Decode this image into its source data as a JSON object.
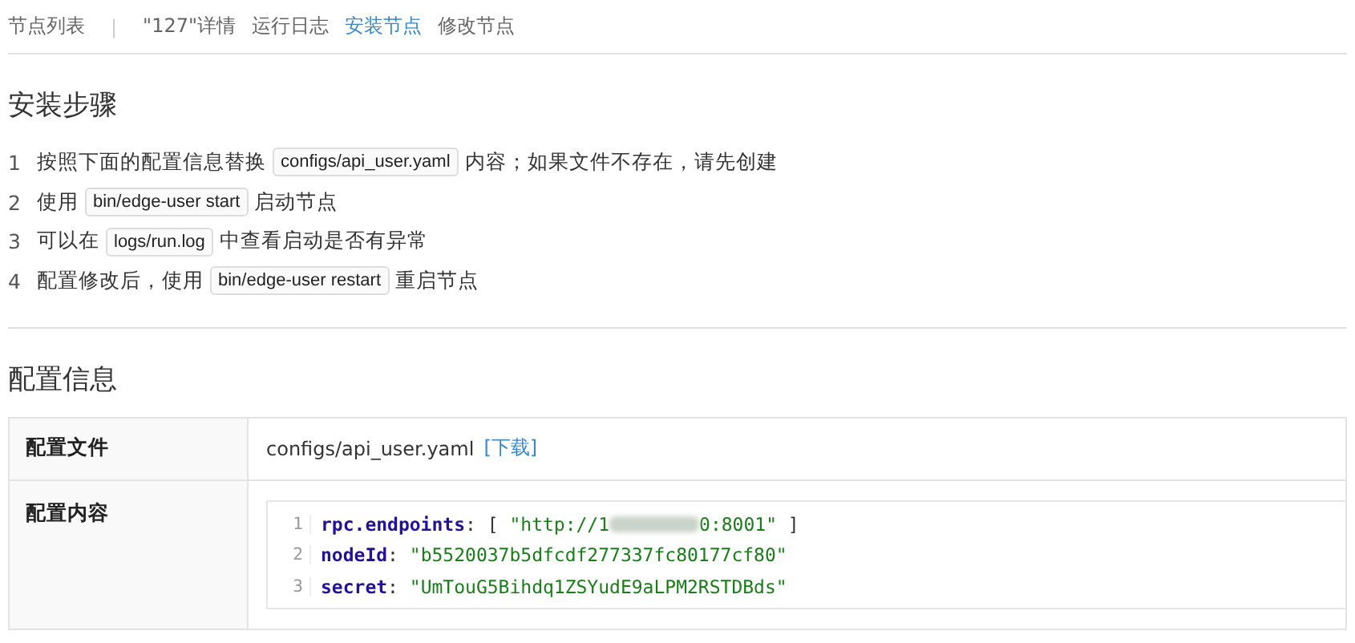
{
  "tabs": [
    {
      "label": "节点列表",
      "selected": false
    },
    {
      "label": "\"127\"详情",
      "selected": false
    },
    {
      "label": "运行日志",
      "selected": false
    },
    {
      "label": "安装节点",
      "selected": true
    },
    {
      "label": "修改节点",
      "selected": false
    }
  ],
  "tab_separator": "|",
  "install": {
    "title": "安装步骤",
    "steps": [
      {
        "number": "1",
        "parts": [
          {
            "kind": "text",
            "text": "按照下面的配置信息替换"
          },
          {
            "kind": "code",
            "text": "configs/api_user.yaml"
          },
          {
            "kind": "text",
            "text": "内容；如果文件不存在，请先创建"
          }
        ]
      },
      {
        "number": "2",
        "parts": [
          {
            "kind": "text",
            "text": "使用"
          },
          {
            "kind": "code",
            "text": "bin/edge-user start"
          },
          {
            "kind": "text",
            "text": "启动节点"
          }
        ]
      },
      {
        "number": "3",
        "parts": [
          {
            "kind": "text",
            "text": "可以在"
          },
          {
            "kind": "code",
            "text": "logs/run.log"
          },
          {
            "kind": "text",
            "text": "中查看启动是否有异常"
          }
        ]
      },
      {
        "number": "4",
        "parts": [
          {
            "kind": "text",
            "text": "配置修改后，使用"
          },
          {
            "kind": "code",
            "text": "bin/edge-user restart"
          },
          {
            "kind": "text",
            "text": "重启节点"
          }
        ]
      }
    ]
  },
  "config": {
    "title": "配置信息",
    "file_row": {
      "label": "配置文件",
      "value": "configs/api_user.yaml",
      "link": "[下载]"
    },
    "content_row": {
      "label": "配置内容",
      "lines": [
        {
          "number": "1",
          "segments": [
            {
              "kind": "key",
              "text": "rpc.endpoints"
            },
            {
              "kind": "punct",
              "text": ": [ "
            },
            {
              "kind": "string",
              "text": "\"http://1"
            },
            {
              "kind": "redacted"
            },
            {
              "kind": "string",
              "text": "0:8001\""
            },
            {
              "kind": "punct",
              "text": " ]"
            }
          ]
        },
        {
          "number": "2",
          "segments": [
            {
              "kind": "key",
              "text": "nodeId"
            },
            {
              "kind": "punct",
              "text": ": "
            },
            {
              "kind": "string",
              "text": "\"b5520037b5dfcdf277337fc80177cf80\""
            }
          ]
        },
        {
          "number": "3",
          "segments": [
            {
              "kind": "key",
              "text": "secret"
            },
            {
              "kind": "punct",
              "text": ": "
            },
            {
              "kind": "string",
              "text": "\"UmTouG5Bihdq1ZSYudE9aLPM2RSTDBds\""
            }
          ]
        }
      ]
    }
  }
}
